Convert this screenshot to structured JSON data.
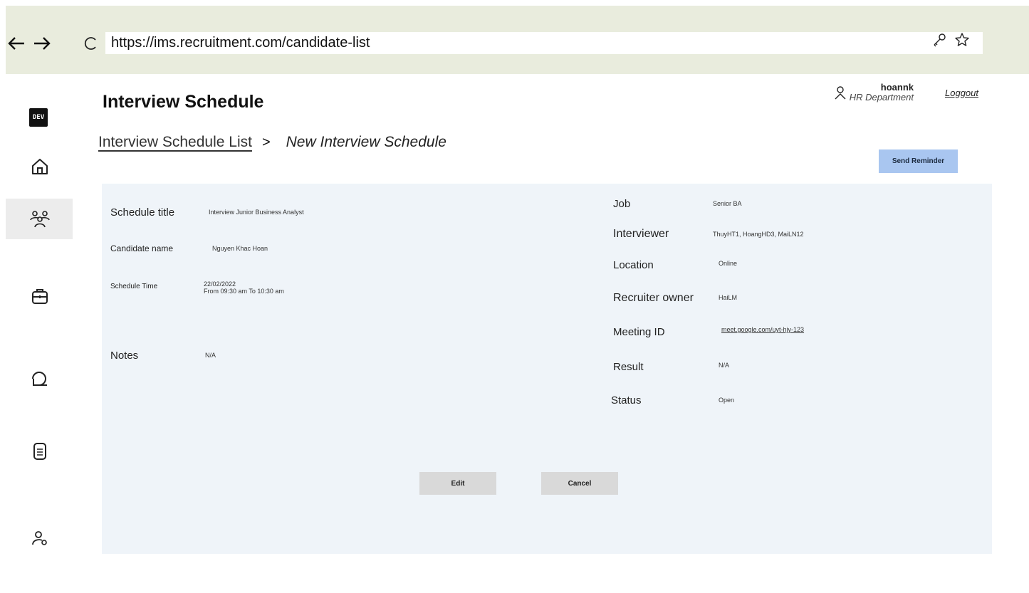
{
  "browser": {
    "url": "https://ims.recruitment.com/candidate-list",
    "back_icon": "arrow-left-icon",
    "forward_icon": "arrow-right-icon",
    "reload_icon": "reload-icon"
  },
  "sidebar": {
    "logo": "DEV",
    "items": [
      {
        "icon": "home-icon"
      },
      {
        "icon": "candidates-icon"
      },
      {
        "icon": "briefcase-icon"
      },
      {
        "icon": "chat-icon"
      },
      {
        "icon": "document-icon"
      },
      {
        "icon": "user-settings-icon"
      }
    ]
  },
  "header": {
    "title": "Interview Schedule",
    "breadcrumb_parent": "Interview Schedule List",
    "breadcrumb_sep": ">",
    "breadcrumb_current": "New Interview Schedule",
    "username": "hoannk",
    "department": "HR Department",
    "logout": "Loggout",
    "send_reminder": "Send Reminder"
  },
  "details": {
    "left": {
      "schedule_title_label": "Schedule title",
      "schedule_title_value": "Interview Junior Business Analyst",
      "candidate_name_label": "Candidate name",
      "candidate_name_value": "Nguyen Khac Hoan",
      "schedule_time_label": "Schedule Time",
      "schedule_time_date": "22/02/2022",
      "schedule_time_range": "From 09:30 am To 10:30 am",
      "notes_label": "Notes",
      "notes_value": "N/A"
    },
    "right": {
      "job_label": "Job",
      "job_value": "Senior BA",
      "interviewer_label": "Interviewer",
      "interviewer_value": "ThuyHT1, HoangHD3, MaiLN12",
      "location_label": "Location",
      "location_value": "Online",
      "recruiter_label": "Recruiter owner",
      "recruiter_value": "HaiLM",
      "meeting_label": "Meeting ID",
      "meeting_value": "meet.google.com/uyt-hjy-123",
      "result_label": "Result",
      "result_value": "N/A",
      "status_label": "Status",
      "status_value": "Open"
    }
  },
  "actions": {
    "edit": "Edit",
    "cancel": "Cancel"
  }
}
